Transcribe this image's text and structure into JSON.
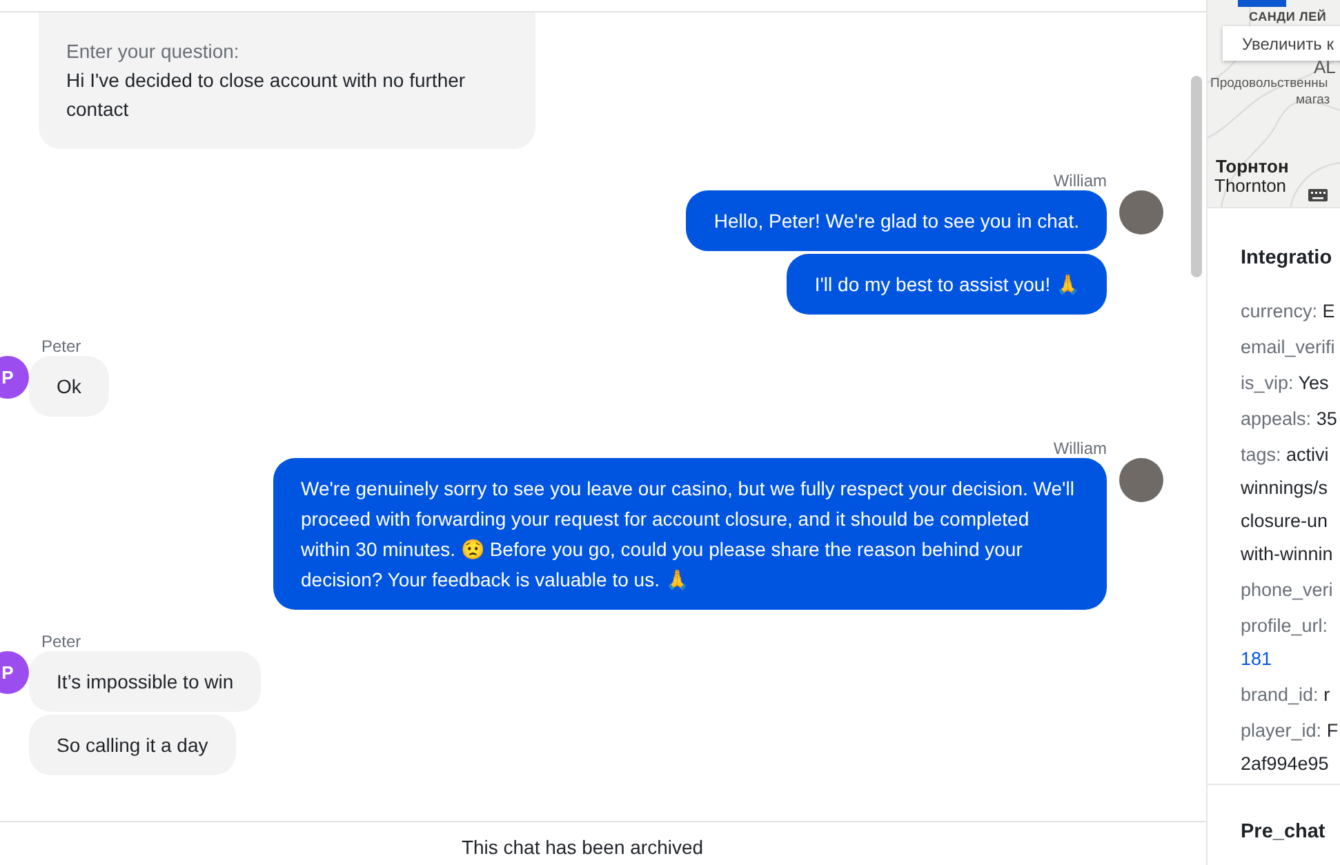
{
  "first_message": {
    "label": "Enter your question:",
    "text": "Hi I've decided to close account with no further contact"
  },
  "messages": [
    {
      "sender": "William",
      "kind": "agent",
      "bubbles": [
        "Hello, Peter! We're glad to see you in chat.",
        "I'll do my best to assist you! 🙏"
      ]
    },
    {
      "sender": "Peter",
      "kind": "customer",
      "initial": "P",
      "bubbles": [
        "Ok"
      ]
    },
    {
      "sender": "William",
      "kind": "agent",
      "bubbles": [
        "We're genuinely sorry to see you leave our casino, but we fully respect your decision. We'll proceed with forwarding your request for account closure, and it should be completed within 30 minutes. 😟 Before you go, could you please share the reason behind your decision? Your feedback is valuable to us. 🙏"
      ]
    },
    {
      "sender": "Peter",
      "kind": "customer",
      "initial": "P",
      "bubbles": [
        "It’s impossible to win",
        "So calling it a day"
      ]
    }
  ],
  "archived_notice": "This chat has been archived",
  "map": {
    "street": "САНДИ ЛЕЙ",
    "zoom_button": "Увеличить к",
    "labels": [
      {
        "kind": "small",
        "text": "AL"
      },
      {
        "kind": "tiny",
        "text": "Продовольственны"
      },
      {
        "kind": "tiny2",
        "text": "магаз"
      },
      {
        "kind": "city",
        "text": "Торнтон"
      },
      {
        "kind": "city2",
        "text": "Thornton"
      }
    ]
  },
  "integration": {
    "title": "Integratio",
    "fields": [
      {
        "key": "currency:",
        "kind": "text",
        "lines": [
          "E"
        ]
      },
      {
        "key": "email_verifi",
        "kind": "text"
      },
      {
        "key": "is_vip:",
        "kind": "text",
        "lines": [
          "Yes"
        ]
      },
      {
        "key": "appeals:",
        "kind": "text",
        "lines": [
          "35"
        ]
      },
      {
        "key": "tags:",
        "kind": "text",
        "lines": [
          "activi",
          "winnings/s",
          "closure-un",
          "with-winnin"
        ]
      },
      {
        "key": "phone_veri",
        "kind": "text"
      },
      {
        "key": "profile_url:",
        "kind": "link",
        "lines": [
          "181"
        ]
      },
      {
        "key": "brand_id:",
        "kind": "text",
        "lines": [
          "r"
        ]
      },
      {
        "key": "player_id:",
        "kind": "text",
        "lines": [
          "F",
          "2af994e95"
        ]
      }
    ]
  },
  "prechat": {
    "title": "Pre_chat"
  }
}
